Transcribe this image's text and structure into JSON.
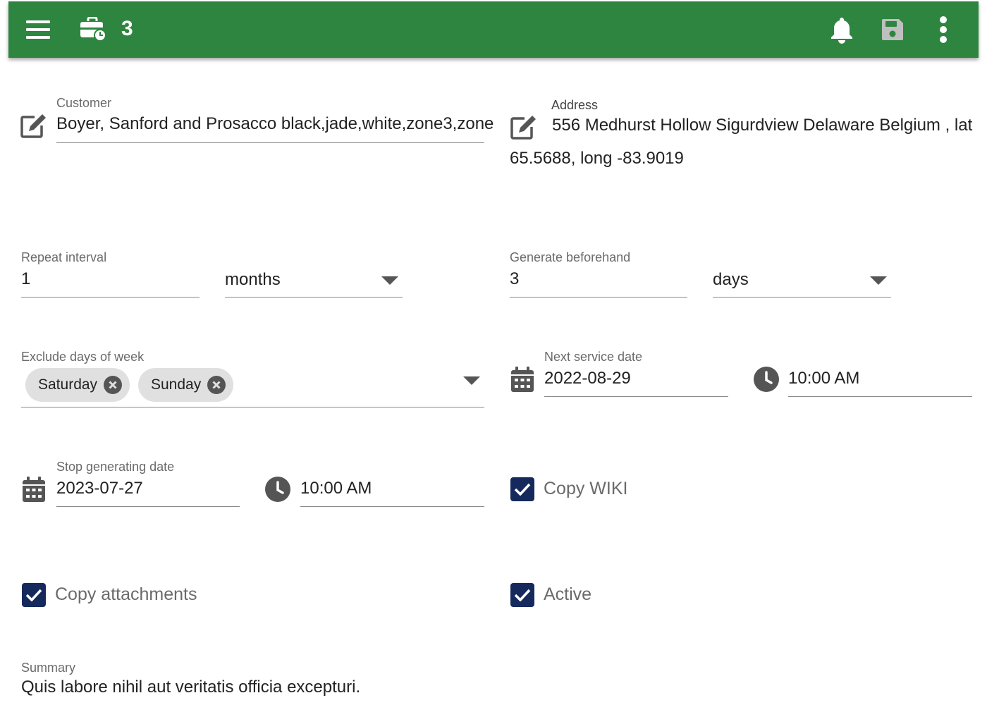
{
  "appbar": {
    "job_count": "3",
    "colors": {
      "background": "#2e8540",
      "icon": "#ffffff",
      "save_icon": "#bfbfbf"
    },
    "icons": [
      "menu-icon",
      "briefcase-clock-icon",
      "bell-icon",
      "save-icon",
      "more-vert-icon"
    ]
  },
  "customer": {
    "label": "Customer",
    "value": "Boyer, Sanford and Prosacco black,jade,white,zone3,zone"
  },
  "address": {
    "label": "Address",
    "line1": "556 Medhurst Hollow Sigurdview Delaware Belgium , lat",
    "line2": "65.5688, long -83.9019"
  },
  "repeat_interval": {
    "label": "Repeat interval",
    "value": "1",
    "unit": "months"
  },
  "generate_beforehand": {
    "label": "Generate beforehand",
    "value": "3",
    "unit": "days"
  },
  "exclude_days": {
    "label": "Exclude days of week",
    "chips": [
      "Saturday",
      "Sunday"
    ]
  },
  "next_service": {
    "label": "Next service date",
    "date": "2022-08-29",
    "time": "10:00 AM"
  },
  "stop_generating": {
    "label": "Stop generating date",
    "date": "2023-07-27",
    "time": "10:00 AM"
  },
  "checkboxes": {
    "copy_wiki": {
      "label": "Copy WIKI",
      "checked": true
    },
    "copy_attachments": {
      "label": "Copy attachments",
      "checked": true
    },
    "active": {
      "label": "Active",
      "checked": true
    },
    "color": "#15295c"
  },
  "summary": {
    "label": "Summary",
    "value": "Quis labore nihil aut veritatis officia excepturi."
  }
}
